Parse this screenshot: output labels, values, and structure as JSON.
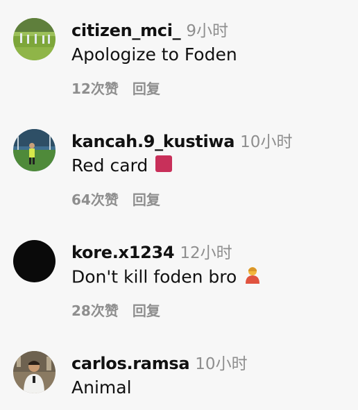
{
  "comments": [
    {
      "username": "citizen_mci_",
      "time": "9小时",
      "text": "Apologize to Foden",
      "likes": "12次赞",
      "reply": "回复",
      "avatar": "football-pitch-photo"
    },
    {
      "username": "kancah.9_kustiwa",
      "time": "10小时",
      "text": "Red card",
      "emoji": "red-square-emoji",
      "likes": "64次赞",
      "reply": "回复",
      "avatar": "player-on-pitch-photo"
    },
    {
      "username": "kore.x1234",
      "time": "12小时",
      "text": "Don't kill foden bro",
      "emoji": "person-emoji",
      "likes": "28次赞",
      "reply": "回复",
      "avatar": "black-circle"
    },
    {
      "username": "carlos.ramsa",
      "time": "10小时",
      "text": "Animal",
      "avatar": "person-portrait-photo"
    }
  ],
  "colors": {
    "background": "#f7f7f7",
    "secondary_text": "#8e8e8e",
    "red_square": "#c8305a"
  }
}
